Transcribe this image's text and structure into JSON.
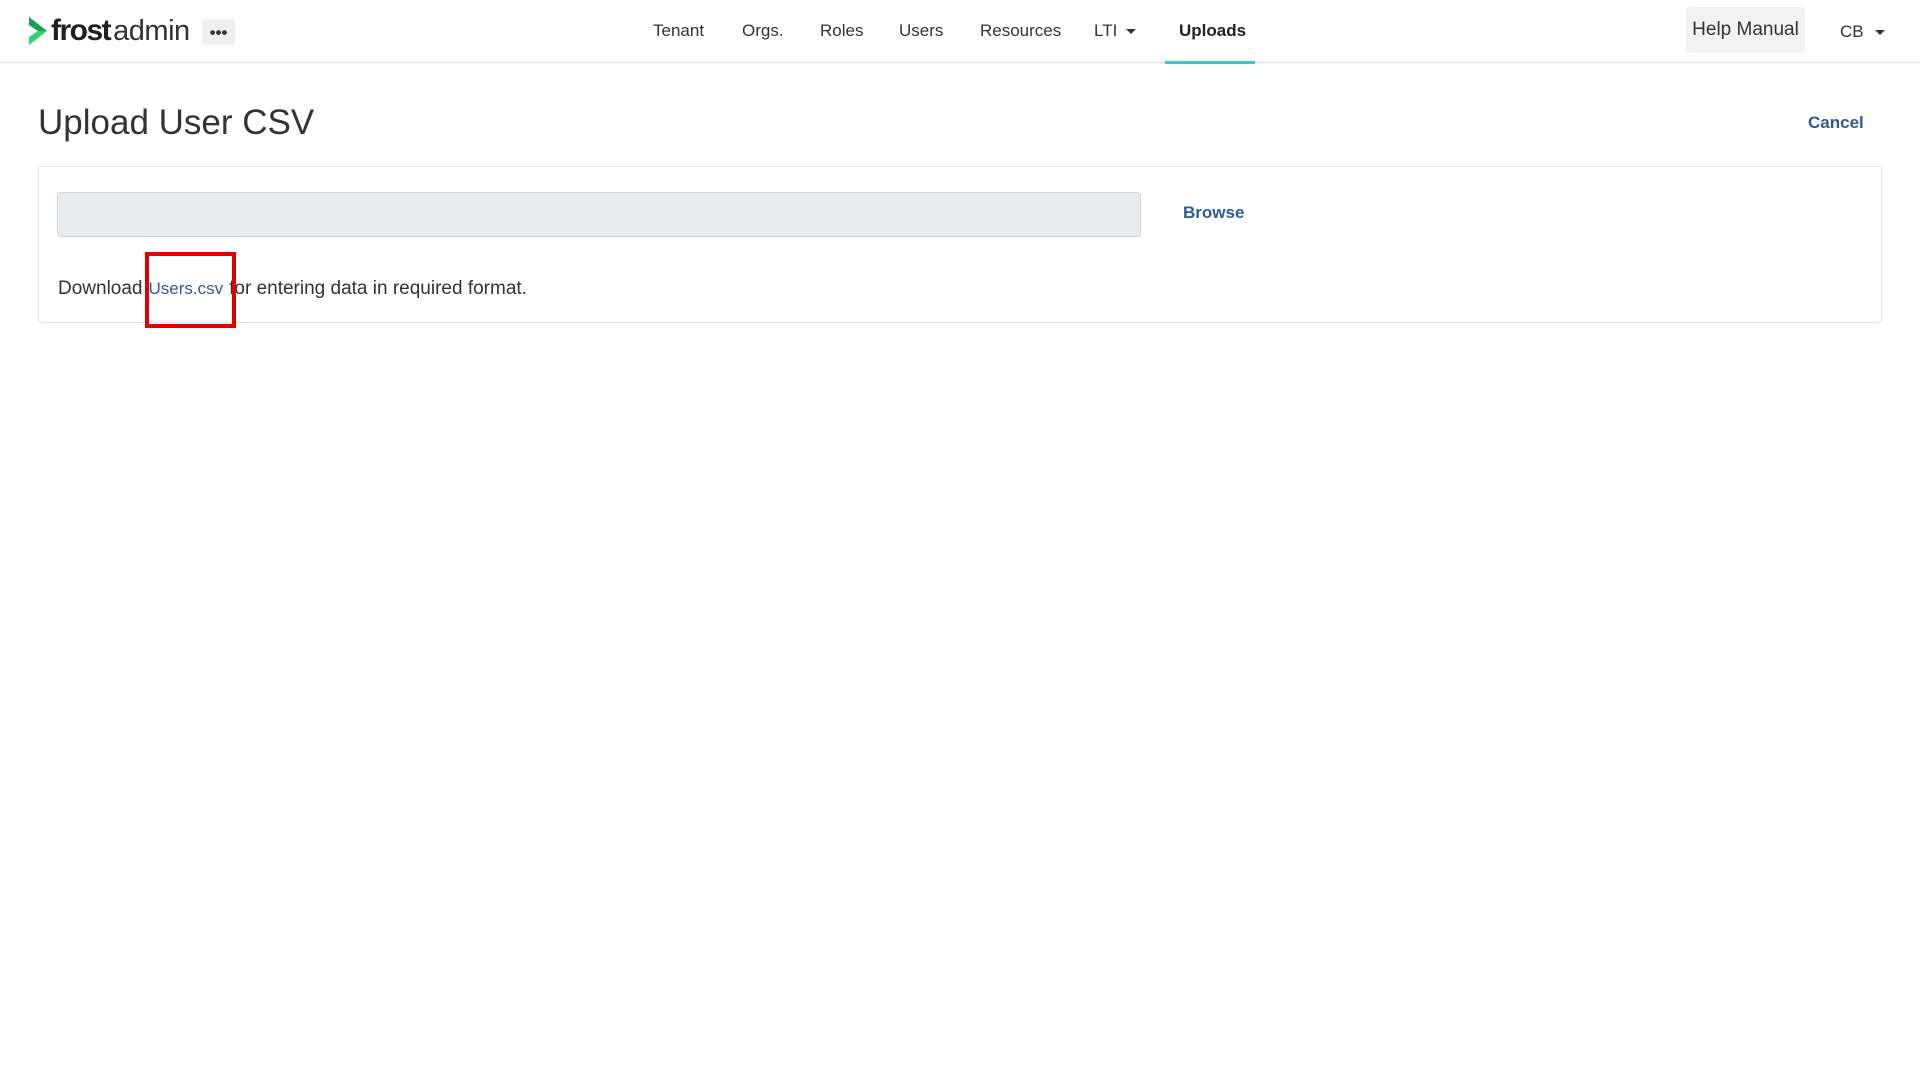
{
  "brand": {
    "name_bold": "frost",
    "name_light": "admin",
    "accent_color": "#2fd36f"
  },
  "header": {
    "more_label": "•••",
    "nav": [
      {
        "label": "Tenant"
      },
      {
        "label": "Orgs."
      },
      {
        "label": "Roles"
      },
      {
        "label": "Users"
      },
      {
        "label": "Resources"
      },
      {
        "label": "LTI",
        "has_dropdown": true
      },
      {
        "label": "Uploads",
        "active": true
      }
    ],
    "help_label": "Help Manual",
    "user_initials": "CB",
    "active_underline_color": "#3cc6c9"
  },
  "page": {
    "title": "Upload User CSV",
    "cancel_label": "Cancel"
  },
  "upload": {
    "file_value": "",
    "browse_label": "Browse",
    "download_prefix": "Download",
    "template_link": "Users.csv",
    "download_suffix": "for entering data in required format."
  },
  "annotation": {
    "highlight_color": "#e00000"
  }
}
